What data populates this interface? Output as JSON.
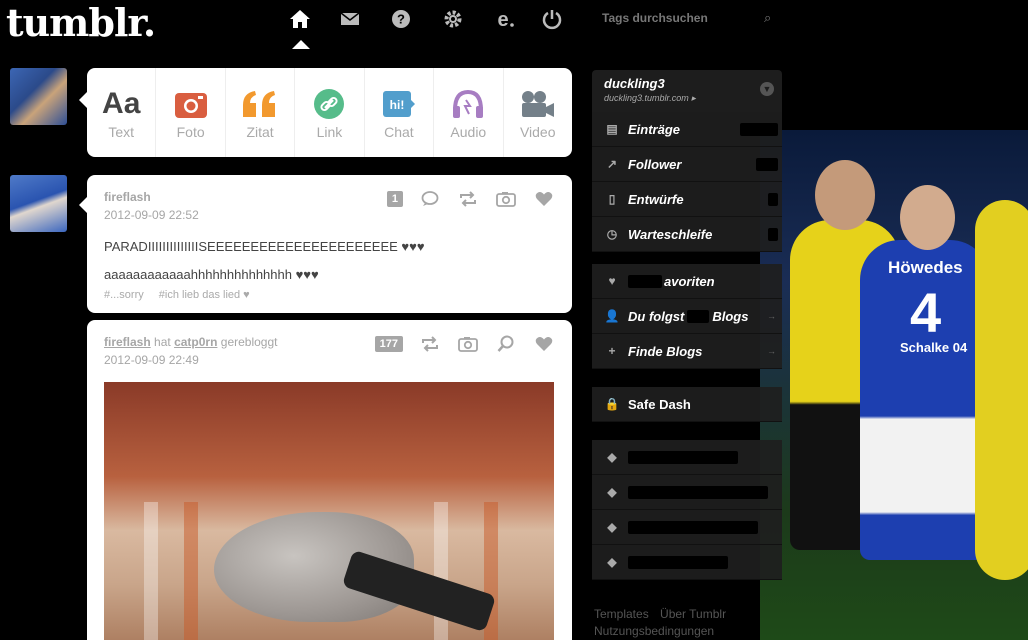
{
  "header": {
    "logo": "tumblr.",
    "nav": [
      {
        "name": "home-icon",
        "active": true
      },
      {
        "name": "mail-icon"
      },
      {
        "name": "help-icon"
      },
      {
        "name": "gear-icon"
      },
      {
        "name": "e-icon"
      },
      {
        "name": "power-icon"
      }
    ],
    "search_placeholder": "Tags durchsuchen"
  },
  "post_types": [
    {
      "label": "Text",
      "glyph": "Aa",
      "color": "#444444"
    },
    {
      "label": "Foto",
      "color": "#d95e40"
    },
    {
      "label": "Zitat",
      "color": "#f2992e"
    },
    {
      "label": "Link",
      "color": "#56bc8a"
    },
    {
      "label": "Chat",
      "glyph": "hi!",
      "color": "#529ecc"
    },
    {
      "label": "Audio",
      "color": "#a77dc2"
    },
    {
      "label": "Video",
      "color": "#748089"
    }
  ],
  "posts": [
    {
      "author": "fireflash",
      "date": "2012-09-09 22:52",
      "notes": "1",
      "line1": "PARADIIIIIIIIIIIIIISEEEEEEEEEEEEEEEEEEEEEE ♥♥♥",
      "line2": "aaaaaaaaaaaahhhhhhhhhhhhhh ♥♥♥",
      "tags": [
        "#...sorry",
        "#ich lieb das lied ♥"
      ]
    },
    {
      "author": "fireflash",
      "reblog_text": "hat",
      "source": "catp0rn",
      "reblog_suffix": "gerebloggt",
      "date": "2012-09-09 22:49",
      "notes": "177"
    }
  ],
  "sidebar": {
    "blog_name": "duckling3",
    "blog_url": "duckling3.tumblr.com ▸",
    "items": [
      {
        "label": "Einträge"
      },
      {
        "label": "Follower"
      },
      {
        "label": "Entwürfe"
      },
      {
        "label": "Warteschleife"
      }
    ],
    "items2": [
      {
        "label": "avoriten"
      },
      {
        "label_prefix": "Du folgst",
        "label_suffix": "Blogs"
      },
      {
        "label": "Finde Blogs"
      }
    ],
    "safe_dash": "Safe Dash"
  },
  "footer": {
    "links": [
      "Templates",
      "Über Tumblr"
    ],
    "line2": "Nutzungsbedingungen"
  },
  "jersey": {
    "name": "Höwedes",
    "number": "4",
    "sponsor": "Schalke 04"
  }
}
